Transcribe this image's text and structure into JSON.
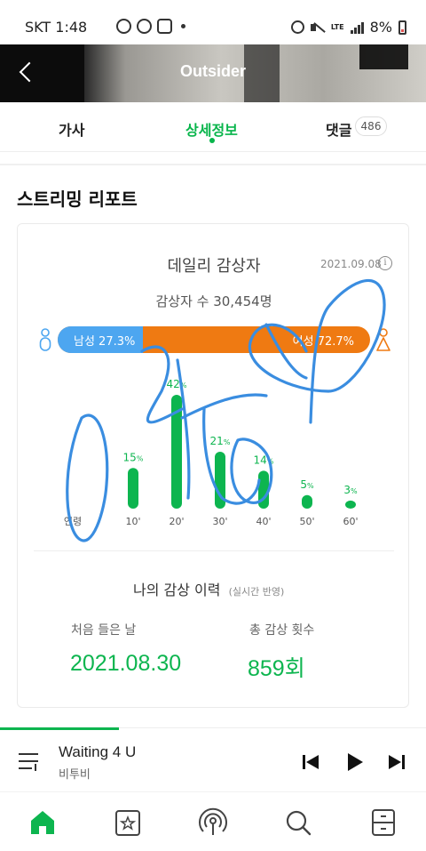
{
  "status_bar": {
    "carrier_time": "SKT 1:48",
    "network": "LTE",
    "battery": "8%"
  },
  "header": {
    "title": "Outsider"
  },
  "tabs": [
    {
      "label": "가사"
    },
    {
      "label": "상세정보",
      "active": true
    },
    {
      "label": "댓글",
      "count": "486"
    }
  ],
  "report": {
    "section_title": "스트리밍 리포트",
    "card_title": "데일리 감상자",
    "date": "2021.09.08",
    "listener_count": "감상자 수 30,454명",
    "male_label": "남성 27.3%",
    "female_label": "여성 72.7%",
    "male_fraction": 0.273,
    "colors": {
      "male": "#4da6f0",
      "female": "#ef7a12",
      "accent": "#0db54f"
    }
  },
  "chart_data": {
    "type": "bar",
    "xlabel": "연령",
    "categories": [
      "10'",
      "20'",
      "30'",
      "40'",
      "50'",
      "60'"
    ],
    "values": [
      15,
      42,
      21,
      14,
      5,
      3
    ],
    "unit": "%",
    "ylim": [
      0,
      42
    ]
  },
  "history": {
    "title": "나의 감상 이력",
    "subtitle": "(실시간 반영)",
    "first_listen_label": "처음 들은 날",
    "first_listen_value": "2021.08.30",
    "total_plays_label": "총 감상 횟수",
    "total_plays_value": "859회"
  },
  "player": {
    "song_title": "Waiting 4 U",
    "artist": "비투비",
    "progress": 0.28
  },
  "bottom_nav": [
    {
      "icon": "home-icon",
      "active": true
    },
    {
      "icon": "my-music-icon"
    },
    {
      "icon": "podcast-icon"
    },
    {
      "icon": "search-icon"
    },
    {
      "icon": "library-icon"
    }
  ]
}
